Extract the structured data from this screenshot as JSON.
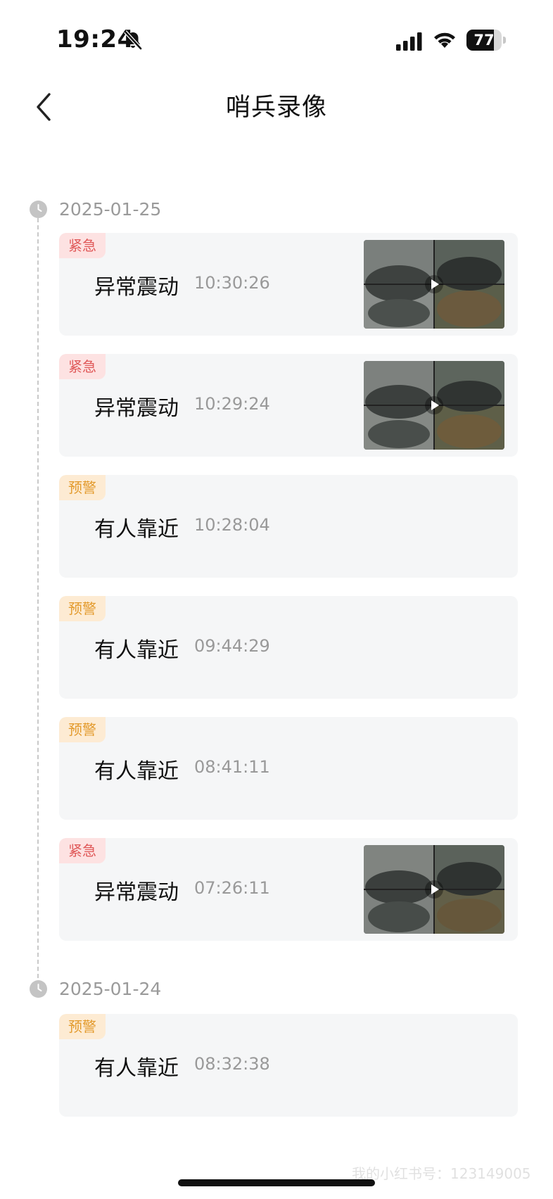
{
  "status_bar": {
    "time": "19:24",
    "battery": 77
  },
  "header": {
    "title": "哨兵录像"
  },
  "groups": [
    {
      "date": "2025-01-25",
      "events": [
        {
          "tag": "紧急",
          "level": "urgent",
          "name": "异常震动",
          "time": "10:30:26",
          "has_thumbnail": true
        },
        {
          "tag": "紧急",
          "level": "urgent",
          "name": "异常震动",
          "time": "10:29:24",
          "has_thumbnail": true
        },
        {
          "tag": "预警",
          "level": "warn",
          "name": "有人靠近",
          "time": "10:28:04",
          "has_thumbnail": false
        },
        {
          "tag": "预警",
          "level": "warn",
          "name": "有人靠近",
          "time": "09:44:29",
          "has_thumbnail": false
        },
        {
          "tag": "预警",
          "level": "warn",
          "name": "有人靠近",
          "time": "08:41:11",
          "has_thumbnail": false
        },
        {
          "tag": "紧急",
          "level": "urgent",
          "name": "异常震动",
          "time": "07:26:11",
          "has_thumbnail": true
        }
      ]
    },
    {
      "date": "2025-01-24",
      "events": [
        {
          "tag": "预警",
          "level": "warn",
          "name": "有人靠近",
          "time": "08:32:38",
          "has_thumbnail": false
        }
      ]
    }
  ],
  "colors": {
    "urgent": "#e05a5a",
    "warn": "#e39a2c",
    "card_bg": "#f5f6f7"
  },
  "watermark": "我的小红书号：123149005"
}
